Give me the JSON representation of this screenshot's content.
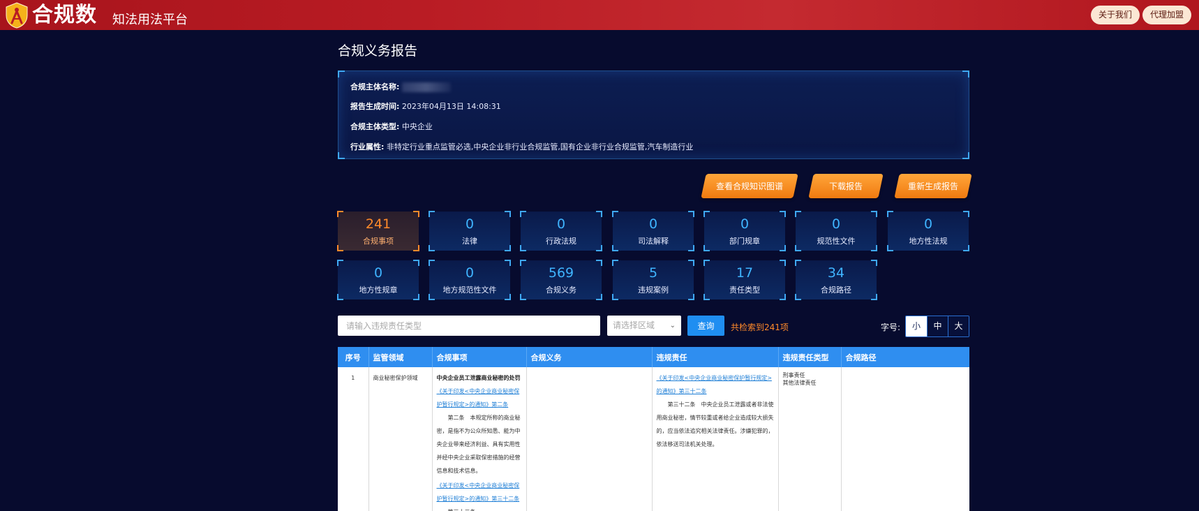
{
  "header": {
    "brand": "合规数",
    "tagline": "知法用法平台",
    "about_label": "关于我们",
    "join_label": "代理加盟"
  },
  "page_title": "合规义务报告",
  "info": {
    "subject_name_label": "合规主体名称:",
    "time_label": "报告生成时间:",
    "time_value": "2023年04月13日 14:08:31",
    "type_label": "合规主体类型:",
    "type_value": "中央企业",
    "industry_label": "行业属性:",
    "industry_value": "非特定行业重点监管必选,中央企业非行业合规监管,国有企业非行业合规监管,汽车制造行业"
  },
  "actions": {
    "graph": "查看合规知识图谱",
    "download": "下载报告",
    "regen": "重新生成报告"
  },
  "stats": [
    {
      "num": "241",
      "label": "合规事项"
    },
    {
      "num": "0",
      "label": "法律"
    },
    {
      "num": "0",
      "label": "行政法规"
    },
    {
      "num": "0",
      "label": "司法解释"
    },
    {
      "num": "0",
      "label": "部门规章"
    },
    {
      "num": "0",
      "label": "规范性文件"
    },
    {
      "num": "0",
      "label": "地方性法规"
    },
    {
      "num": "0",
      "label": "地方性规章"
    },
    {
      "num": "0",
      "label": "地方规范性文件"
    },
    {
      "num": "569",
      "label": "合规义务"
    },
    {
      "num": "5",
      "label": "违规案例"
    },
    {
      "num": "17",
      "label": "责任类型"
    },
    {
      "num": "34",
      "label": "合规路径"
    }
  ],
  "filter": {
    "search_placeholder": "请输入违规责任类型",
    "region_placeholder": "请选择区域",
    "query_label": "查询",
    "result_text": "共检索到241项",
    "font_label": "字号:",
    "font_small": "小",
    "font_medium": "中",
    "font_large": "大"
  },
  "table": {
    "headers": [
      "序号",
      "监管领域",
      "合规事项",
      "合规义务",
      "违规责任",
      "违规责任类型",
      "合规路径"
    ],
    "row1": {
      "no": "1",
      "field": "商业秘密保护领域",
      "item_title": "中央企业员工泄露商业秘密的处罚",
      "item_link1": "《关于印发<中央企业商业秘密保护暂行规定>的通知》第二条",
      "item_text1": "第二条　本规定所称的商业秘密，是指不为公众所知悉、能为中央企业带来经济利益、具有实用性并经中央企业采取保密措施的经营信息和技术信息。",
      "item_link2": "《关于印发<中央企业商业秘密保护暂行规定>的通知》第三十二条",
      "item_text2": "第三十二条",
      "liability_link": "《关于印发<中央企业商业秘密保护暂行规定>的通知》第三十二条",
      "liability_text": "第三十二条　中央企业员工泄露或者非法使用商业秘密，情节较重或者给企业造成较大损失的，应当依法追究相关法律责任。涉嫌犯罪的，依法移送司法机关处理。",
      "liability_type1": "刑事责任",
      "liability_type2": "其他法律责任"
    }
  },
  "colors": {
    "background": "#070b2e",
    "header_red": "#b91c24",
    "accent_orange": "#f07a10",
    "accent_blue": "#3fb4ff",
    "table_header": "#2f8ef0"
  }
}
